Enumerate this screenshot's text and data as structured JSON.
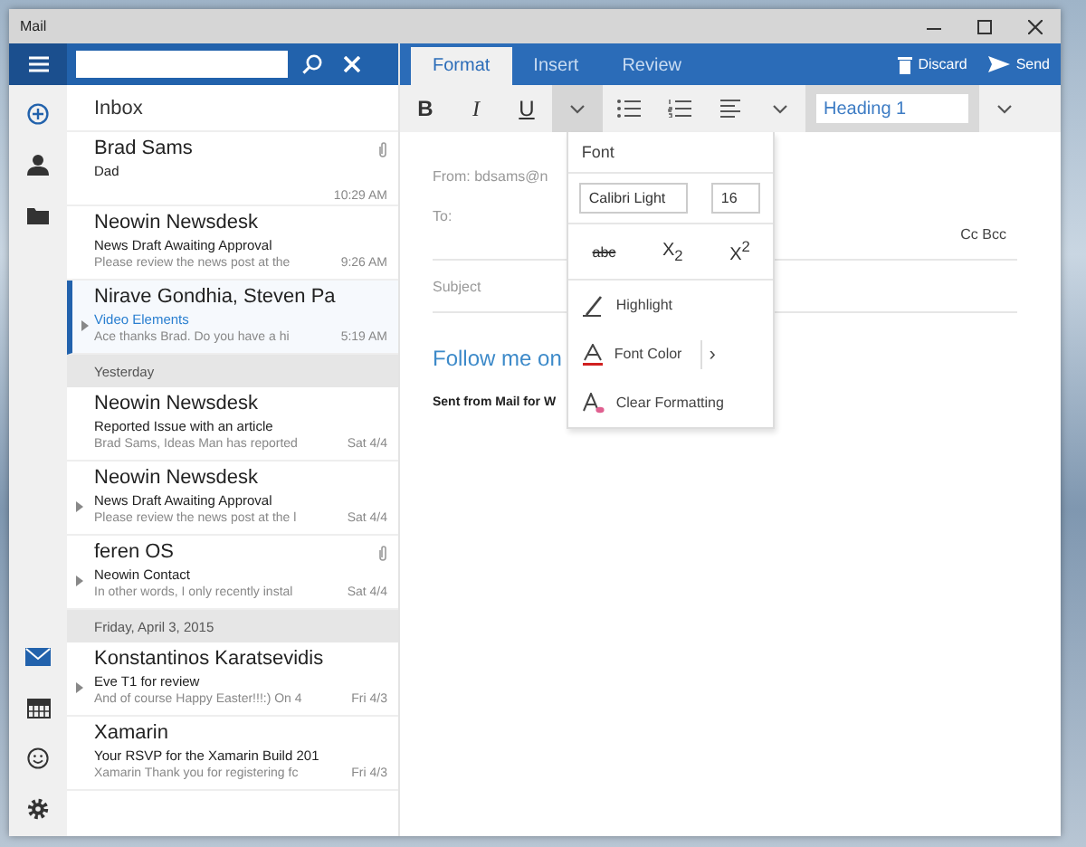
{
  "window": {
    "title": "Mail"
  },
  "rail": {
    "items": [
      {
        "kind": "compose"
      },
      {
        "kind": "people"
      },
      {
        "kind": "folders"
      }
    ],
    "bottom": [
      {
        "kind": "mail",
        "selected": true
      },
      {
        "kind": "calendar",
        "selected": false
      },
      {
        "kind": "feedback",
        "selected": false
      },
      {
        "kind": "settings",
        "selected": false
      }
    ]
  },
  "list": {
    "title": "Inbox",
    "items": [
      {
        "kind": "message",
        "sender": "Brad Sams",
        "subject": "Dad",
        "time": "10:29 AM",
        "attachment": true,
        "conversation": false,
        "selected": false
      },
      {
        "kind": "message",
        "sender": "Neowin Newsdesk",
        "subject": "News Draft Awaiting Approval",
        "preview": "Please review the news post at the",
        "time": "9:26 AM",
        "attachment": false,
        "conversation": false,
        "selected": false
      },
      {
        "kind": "message",
        "sender": "Nirave Gondhia, Steven Pa",
        "subject": "Video Elements",
        "preview": "Ace thanks Brad. Do you have a hi",
        "time": "5:19 AM",
        "attachment": false,
        "conversation": true,
        "selected": true
      },
      {
        "kind": "date",
        "label": "Yesterday"
      },
      {
        "kind": "message",
        "sender": "Neowin Newsdesk",
        "subject": "Reported Issue with an article",
        "preview": "Brad Sams, Ideas Man has reported",
        "time": "Sat 4/4",
        "attachment": false,
        "conversation": false,
        "selected": false
      },
      {
        "kind": "message",
        "sender": "Neowin Newsdesk",
        "subject": "News Draft Awaiting Approval",
        "preview": "Please review the news post at the l",
        "time": "Sat 4/4",
        "attachment": false,
        "conversation": true,
        "selected": false
      },
      {
        "kind": "message",
        "sender": "feren OS",
        "subject": "Neowin Contact",
        "preview": "In other words, I only recently instal",
        "time": "Sat 4/4",
        "attachment": true,
        "conversation": true,
        "selected": false
      },
      {
        "kind": "date",
        "label": "Friday, April 3, 2015"
      },
      {
        "kind": "message",
        "sender": "Konstantinos Karatsevidis",
        "subject": "Eve T1 for review",
        "preview": "And of course Happy Easter!!!:) On 4",
        "time": "Fri 4/3",
        "attachment": false,
        "conversation": true,
        "selected": false
      },
      {
        "kind": "message",
        "sender": "Xamarin",
        "subject": "Your RSVP for the Xamarin Build 201",
        "preview": "Xamarin Thank you for registering fc",
        "time": "Fri 4/3",
        "attachment": false,
        "conversation": false,
        "selected": false
      }
    ]
  },
  "compose": {
    "tabs": [
      {
        "label": "Format",
        "selected": true
      },
      {
        "label": "Insert",
        "selected": false
      },
      {
        "label": "Review",
        "selected": false
      }
    ],
    "actions": [
      {
        "kind": "discard",
        "label": "Discard"
      },
      {
        "kind": "send",
        "label": "Send"
      }
    ],
    "format_buttons": [
      {
        "kind": "bold",
        "label": "B"
      },
      {
        "kind": "italic",
        "label": "I"
      },
      {
        "kind": "underline",
        "label": "U"
      }
    ],
    "font_menu_button": {
      "expanded": true
    },
    "style_value": "Heading 1",
    "from_label": "From:",
    "from_value": "bdsams@n",
    "to_label": "To:",
    "cc_bcc": "Cc Bcc",
    "subject_placeholder": "Subject",
    "body": [
      {
        "kind": "link_heading",
        "text": "Follow me on"
      },
      {
        "kind": "signature",
        "text": "Sent from Mail for W"
      }
    ],
    "font_menu": {
      "title": "Font",
      "font_name": "Calibri Light",
      "font_size": "16",
      "effects": [
        {
          "kind": "strikethrough",
          "label": "abc"
        },
        {
          "kind": "subscript",
          "label": "X$_{2}$"
        },
        {
          "kind": "superscript",
          "label": "X$^{2}$"
        }
      ],
      "items": [
        {
          "kind": "highlight",
          "label": "Highlight"
        },
        {
          "kind": "font_color",
          "label": "Font Color",
          "submenu": "›"
        },
        {
          "kind": "clear",
          "label": "Clear Formatting"
        }
      ]
    }
  }
}
